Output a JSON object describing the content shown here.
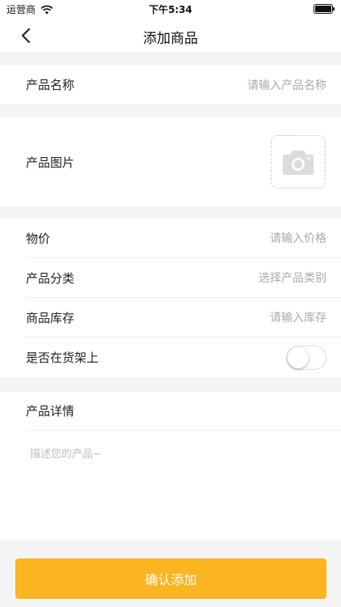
{
  "status_bar": {
    "carrier": "运营商",
    "time": "下午5:34"
  },
  "nav": {
    "title": "添加商品"
  },
  "form": {
    "name": {
      "label": "产品名称",
      "placeholder": "请输入产品名称"
    },
    "image": {
      "label": "产品图片"
    },
    "price": {
      "label": "物价",
      "placeholder": "请输入价格"
    },
    "category": {
      "label": "产品分类",
      "placeholder": "选择产品类别"
    },
    "stock": {
      "label": "商品库存",
      "placeholder": "请输入库存"
    },
    "on_shelf": {
      "label": "是否在货架上",
      "state": "off"
    },
    "detail": {
      "label": "产品详情",
      "placeholder": "描述您的产品~"
    }
  },
  "confirm_button": {
    "label": "确认添加"
  },
  "colors": {
    "accent": "#fbb521",
    "background": "#f4f4f4"
  },
  "icons": {
    "back": "chevron-left-icon",
    "camera": "camera-icon",
    "wifi": "wifi-icon",
    "battery": "battery-icon"
  }
}
